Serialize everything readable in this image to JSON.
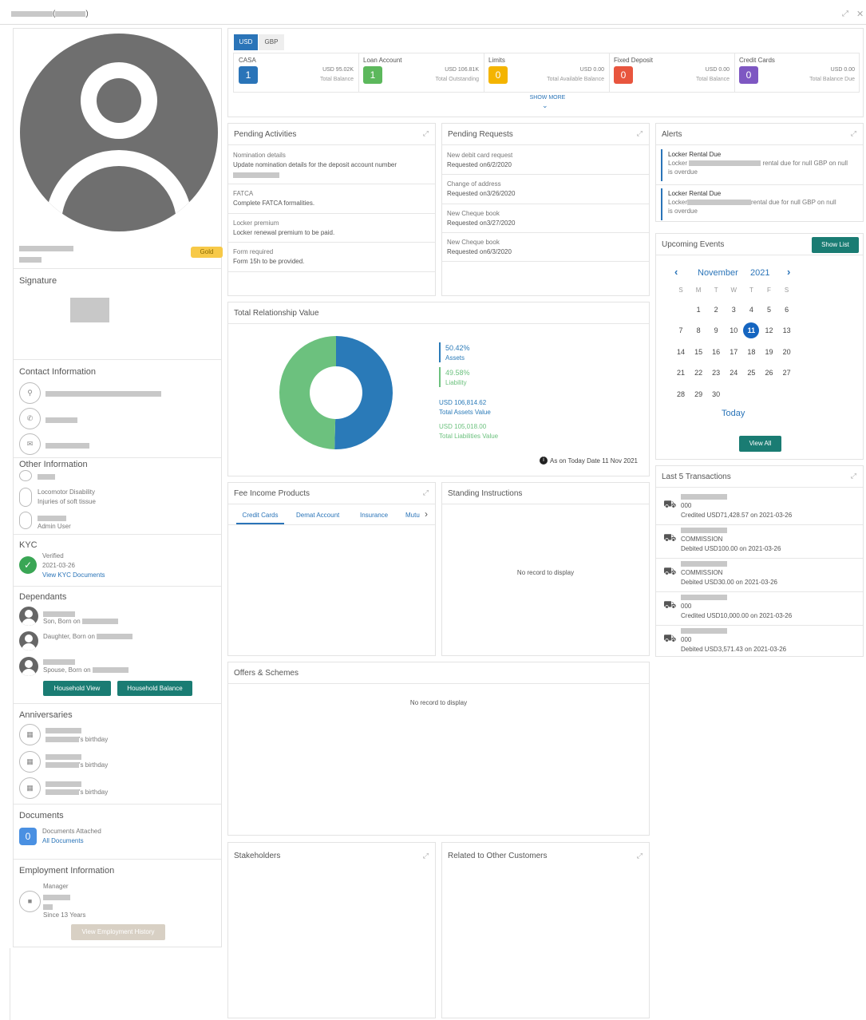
{
  "window": {
    "title_suffix": "(",
    "title_close": ")"
  },
  "profile": {
    "badge": "Gold"
  },
  "signature": {
    "title": "Signature"
  },
  "contact": {
    "title": "Contact Information"
  },
  "other": {
    "title": "Other Information",
    "items": [
      "Locomotor Disability",
      "Injuries of soft tissue",
      "Admin User"
    ]
  },
  "kyc": {
    "title": "KYC",
    "status": "Verified",
    "date": "2021-03-26",
    "link": "View KYC Documents"
  },
  "dependants": {
    "title": "Dependants",
    "items": [
      {
        "rel": "Son, Born on"
      },
      {
        "rel": "Daughter, Born on"
      },
      {
        "rel": "Spouse, Born on"
      }
    ],
    "btn1": "Household View",
    "btn2": "Household Balance"
  },
  "anniversaries": {
    "title": "Anniversaries",
    "suffix": "'s birthday"
  },
  "documents": {
    "title": "Documents",
    "count": "0",
    "attached": "Documents Attached",
    "link": "All Documents"
  },
  "employment": {
    "title": "Employment Information",
    "role": "Manager",
    "since": "Since 13 Years",
    "btn": "View Employment History"
  },
  "currency": {
    "tabs": [
      "USD",
      "GBP"
    ],
    "show_more": "SHOW MORE",
    "cards": [
      {
        "name": "CASA",
        "count": "1",
        "amount": "USD 95.02K",
        "sub": "Total Balance",
        "color": "#2a74b8"
      },
      {
        "name": "Loan Account",
        "count": "1",
        "amount": "USD 106.81K",
        "sub": "Total Outstanding",
        "color": "#5cb85c"
      },
      {
        "name": "Limits",
        "count": "0",
        "amount": "USD 0.00",
        "sub": "Total Available Balance",
        "color": "#f4b400"
      },
      {
        "name": "Fixed Deposit",
        "count": "0",
        "amount": "USD 0.00",
        "sub": "Total Balance",
        "color": "#e8553e"
      },
      {
        "name": "Credit Cards",
        "count": "0",
        "amount": "USD 0.00",
        "sub": "Total Balance Due",
        "color": "#7e57c2"
      }
    ]
  },
  "pending_activities": {
    "title": "Pending Activities",
    "items": [
      {
        "t": "Nomination details",
        "d": "Update nomination details for the deposit account number"
      },
      {
        "t": "FATCA",
        "d": "Complete FATCA formalities."
      },
      {
        "t": "Locker premium",
        "d": "Locker renewal premium to be paid."
      },
      {
        "t": "Form required",
        "d": "Form 15h to be provided."
      }
    ]
  },
  "pending_requests": {
    "title": "Pending Requests",
    "items": [
      {
        "t": "New debit card request",
        "d": "Requested on6/2/2020"
      },
      {
        "t": "Change of address",
        "d": "Requested on3/26/2020"
      },
      {
        "t": "New Cheque book",
        "d": "Requested on3/27/2020"
      },
      {
        "t": "New Cheque book",
        "d": "Requested on6/3/2020"
      }
    ]
  },
  "alerts": {
    "title": "Alerts",
    "items": [
      {
        "t": "Locker Rental Due",
        "a": "Locker",
        "b": "rental due for null GBP on null",
        "c": "is overdue"
      },
      {
        "t": "Locker Rental Due",
        "a": "Locker",
        "b": "rental due for null GBP on null",
        "c": "is overdue"
      }
    ]
  },
  "events": {
    "title": "Upcoming Events",
    "show_list": "Show List",
    "month": "November",
    "year": "2021",
    "today": "Today",
    "view_all": "View All",
    "days": [
      "S",
      "M",
      "T",
      "W",
      "T",
      "F",
      "S"
    ],
    "weeks": [
      [
        "",
        "1",
        "2",
        "3",
        "4",
        "5",
        "6"
      ],
      [
        "7",
        "8",
        "9",
        "10",
        "11",
        "12",
        "13"
      ],
      [
        "14",
        "15",
        "16",
        "17",
        "18",
        "19",
        "20"
      ],
      [
        "21",
        "22",
        "23",
        "24",
        "25",
        "26",
        "27"
      ],
      [
        "28",
        "29",
        "30",
        "",
        "",
        "",
        ""
      ]
    ],
    "selected": "11"
  },
  "trv": {
    "title": "Total Relationship Value",
    "assets_pct": "50.42%",
    "assets_lbl": "Assets",
    "liab_pct": "49.58%",
    "liab_lbl": "Liability",
    "assets_val": "USD 106,814.62",
    "assets_val_lbl": "Total Assets Value",
    "liab_val": "USD 105,018.00",
    "liab_val_lbl": "Total Liabilities Value",
    "asof": "As on Today Date 11 Nov 2021"
  },
  "chart_data": {
    "type": "pie",
    "labels": [
      "Assets",
      "Liability"
    ],
    "values": [
      50.42,
      49.58
    ],
    "colors": [
      "#2a7ab8",
      "#6cc17e"
    ]
  },
  "fee": {
    "title": "Fee Income Products",
    "tabs": [
      "Credit Cards",
      "Demat Account",
      "Insurance",
      "Mutu"
    ]
  },
  "standing": {
    "title": "Standing Instructions",
    "empty": "No record to display"
  },
  "transactions": {
    "title": "Last 5 Transactions",
    "items": [
      {
        "n": "000",
        "d": "Credited USD71,428.57 on 2021-03-26"
      },
      {
        "n": "COMMISSION",
        "d": "Debited USD100.00 on 2021-03-26"
      },
      {
        "n": "COMMISSION",
        "d": "Debited USD30.00 on 2021-03-26"
      },
      {
        "n": "000",
        "d": "Credited USD10,000.00 on 2021-03-26"
      },
      {
        "n": "000",
        "d": "Debited USD3,571.43 on 2021-03-26"
      }
    ]
  },
  "offers": {
    "title": "Offers & Schemes",
    "empty": "No record to display"
  },
  "stakeholders": {
    "title": "Stakeholders"
  },
  "related": {
    "title": "Related to Other Customers"
  }
}
